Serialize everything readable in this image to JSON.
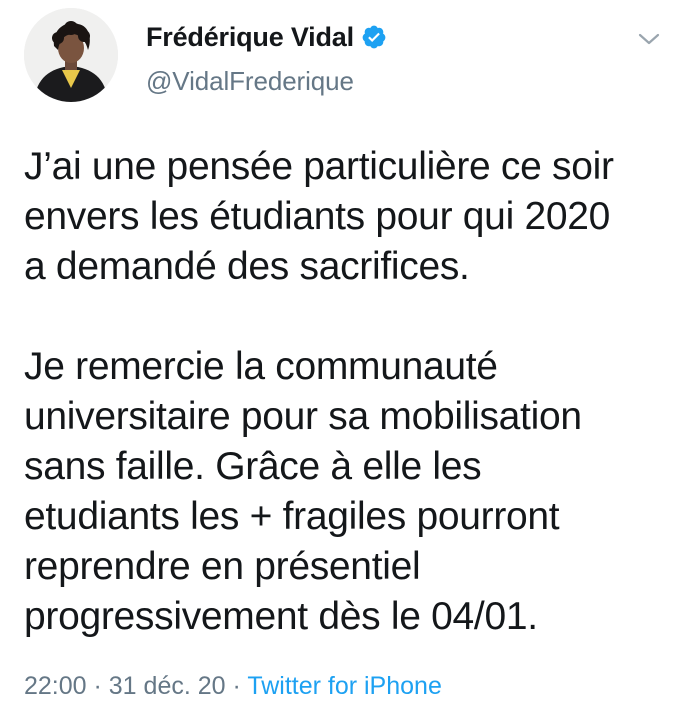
{
  "author": {
    "display_name": "Frédérique Vidal",
    "handle": "@VidalFrederique",
    "verified": true,
    "avatar_icon": "profile-photo"
  },
  "tweet": {
    "paragraph_1": "J’ai une pensée particulière ce soir\nenvers les étudiants pour qui 2020\na demandé des sacrifices.",
    "paragraph_2": "Je remercie la communauté\nuniversitaire pour sa mobilisation\nsans faille. Grâce à elle les\netudiants les + fragiles pourront\nreprendre en présentiel\nprogressivement dès le 04/01."
  },
  "meta": {
    "time": "22:00",
    "separator_1": " · ",
    "date": "31 déc. 20",
    "separator_2": " · ",
    "source": "Twitter for iPhone"
  },
  "icons": {
    "verified": "verified-badge-icon",
    "menu": "chevron-down-icon"
  },
  "colors": {
    "accent": "#1da1f2",
    "muted": "#657786",
    "text": "#14171a"
  }
}
